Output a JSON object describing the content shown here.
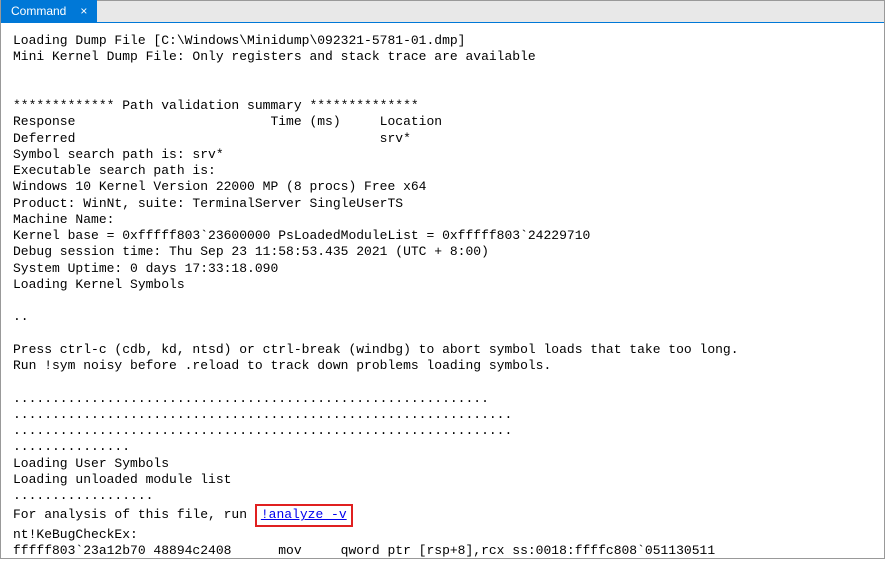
{
  "tab": {
    "title": "Command",
    "close": "×"
  },
  "output": {
    "line1": "Loading Dump File [C:\\Windows\\Minidump\\092321-5781-01.dmp]",
    "line2": "Mini Kernel Dump File: Only registers and stack trace are available",
    "blank1": "",
    "blank2": "",
    "line3": "************* Path validation summary **************",
    "line4": "Response                         Time (ms)     Location",
    "line5": "Deferred                                       srv*",
    "line6": "Symbol search path is: srv*",
    "line7": "Executable search path is:",
    "line8": "Windows 10 Kernel Version 22000 MP (8 procs) Free x64",
    "line9": "Product: WinNt, suite: TerminalServer SingleUserTS",
    "line10": "Machine Name:",
    "line11": "Kernel base = 0xfffff803`23600000 PsLoadedModuleList = 0xfffff803`24229710",
    "line12": "Debug session time: Thu Sep 23 11:58:53.435 2021 (UTC + 8:00)",
    "line13": "System Uptime: 0 days 17:33:18.090",
    "line14": "Loading Kernel Symbols",
    "blank3": "",
    "line15": "..",
    "blank4": "",
    "line16": "Press ctrl-c (cdb, kd, ntsd) or ctrl-break (windbg) to abort symbol loads that take too long.",
    "line17": "Run !sym noisy before .reload to track down problems loading symbols.",
    "blank5": "",
    "line18": ".............................................................",
    "line19": "................................................................",
    "line20": "................................................................",
    "line21": "...............",
    "line22": "Loading User Symbols",
    "line23": "Loading unloaded module list",
    "line24": "..................",
    "line25_prefix": "For analysis of this file, run ",
    "line25_command": "!analyze -v",
    "line26": "nt!KeBugCheckEx:",
    "line27": "fffff803`23a12b70 48894c2408      mov     qword ptr [rsp+8],rcx ss:0018:ffffc808`051130511"
  }
}
